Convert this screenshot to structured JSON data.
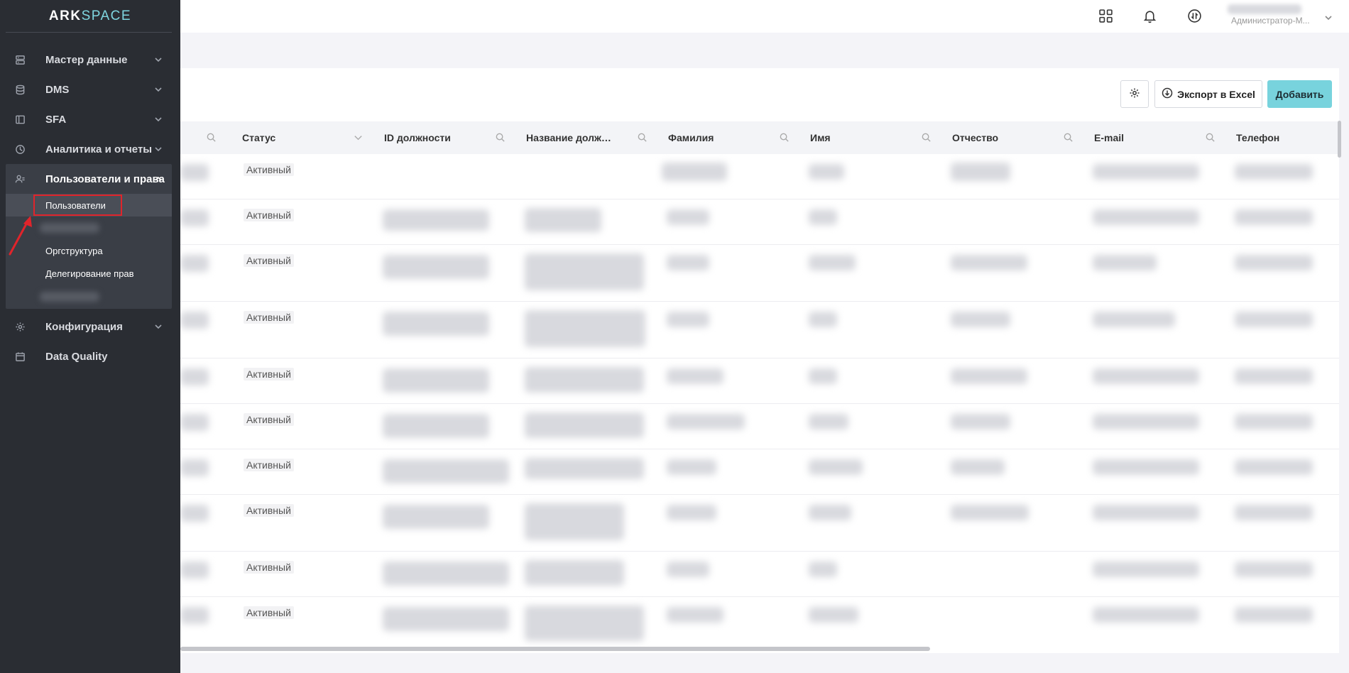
{
  "sidebar": {
    "logo_part1": "ARK",
    "logo_part2": "SPACE",
    "items": [
      {
        "label": "Мастер данные",
        "icon": "server-icon",
        "expanded": false
      },
      {
        "label": "DMS",
        "icon": "database-icon",
        "expanded": false
      },
      {
        "label": "SFA",
        "icon": "layout-icon",
        "expanded": false
      },
      {
        "label": "Аналитика и отчеты",
        "icon": "pie-chart-icon",
        "expanded": false
      },
      {
        "label": "Пользователи и права",
        "icon": "users-icon",
        "expanded": true
      },
      {
        "label": "Конфигурация",
        "icon": "gear-icon",
        "expanded": false
      },
      {
        "label": "Data Quality",
        "icon": "calendar-icon",
        "expanded": false
      }
    ],
    "subitems": [
      {
        "label": "Пользователи",
        "active": true
      },
      {
        "label": "Оргструктура",
        "active": false
      },
      {
        "label": "Делегирование прав",
        "active": false
      }
    ]
  },
  "header": {
    "user_role": "Администратор-М..."
  },
  "toolbar": {
    "export_label": "Экспорт в Excel",
    "add_label": "Добавить"
  },
  "table": {
    "columns": [
      {
        "label": "Статус",
        "icon": "chevron-down-icon"
      },
      {
        "label": "ID должности",
        "icon": "search-icon"
      },
      {
        "label": "Название должн...",
        "icon": "search-icon"
      },
      {
        "label": "Фамилия",
        "icon": "search-icon"
      },
      {
        "label": "Имя",
        "icon": "search-icon"
      },
      {
        "label": "Отчество",
        "icon": "search-icon"
      },
      {
        "label": "E-mail",
        "icon": "search-icon"
      },
      {
        "label": "Телефон",
        "icon": ""
      }
    ],
    "rows": [
      {
        "status": "Активный"
      },
      {
        "status": "Активный"
      },
      {
        "status": "Активный"
      },
      {
        "status": "Активный"
      },
      {
        "status": "Активный"
      },
      {
        "status": "Активный"
      },
      {
        "status": "Активный"
      },
      {
        "status": "Активный"
      },
      {
        "status": "Активный"
      },
      {
        "status": "Активный"
      }
    ]
  },
  "colors": {
    "sidebar_bg": "#2a2d33",
    "accent": "#78d3dd",
    "highlight": "#e0242b"
  }
}
